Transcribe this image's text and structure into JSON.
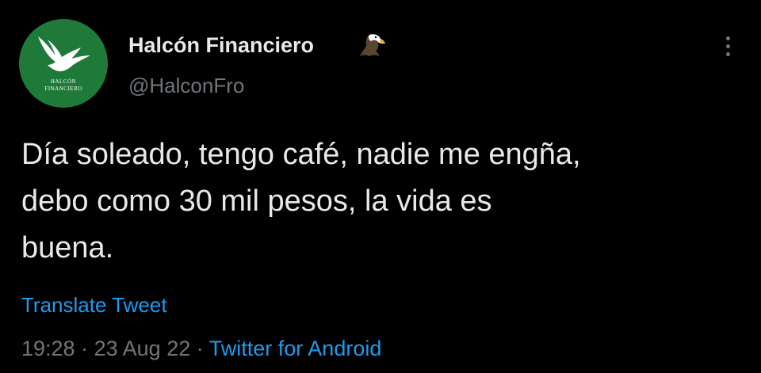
{
  "tweet": {
    "avatar": {
      "icon": "eagle-logo-icon",
      "line1": "HALCÓN",
      "line2": "FINANCIERO",
      "background": "#1f7a3a"
    },
    "display_name": "Halcón Financiero",
    "name_emoji": "eagle-emoji-icon",
    "handle": "@HalconFro",
    "more_icon": "more-vertical-icon",
    "text_lines": [
      "Día soleado, tengo café, nadie me engña,",
      "debo como 30 mil pesos, la vida es",
      "buena."
    ],
    "translate_label": "Translate Tweet",
    "time": "19:28",
    "sep1": "·",
    "date": "23 Aug 22",
    "sep2": "·",
    "source": "Twitter for Android"
  },
  "colors": {
    "background": "#000000",
    "text": "#e7e9ea",
    "secondary": "#71767b",
    "link": "#1d9bf0"
  }
}
